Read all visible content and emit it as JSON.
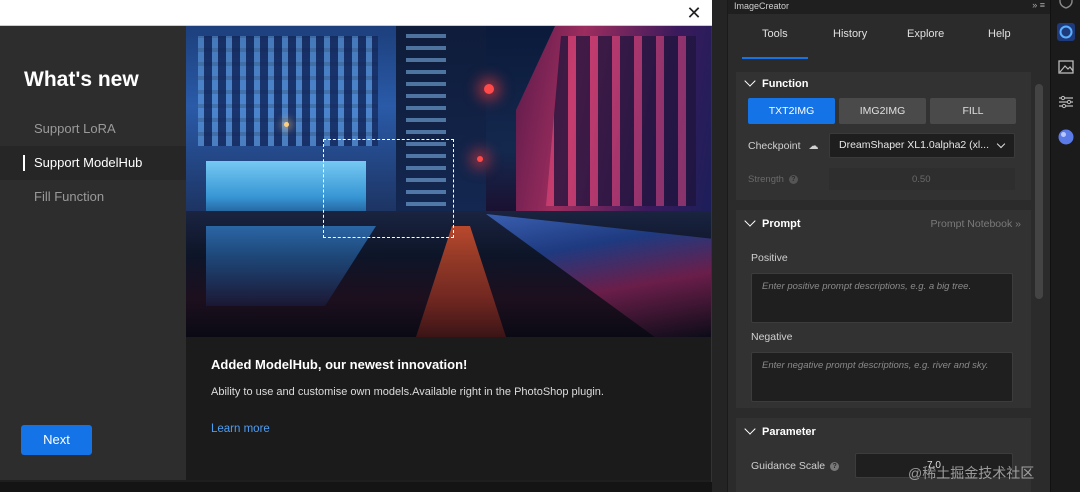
{
  "dialog": {
    "heading": "What's new",
    "nav": [
      {
        "label": "Support LoRA",
        "active": false
      },
      {
        "label": "Support ModelHub",
        "active": true
      },
      {
        "label": "Fill Function",
        "active": false
      }
    ],
    "next_label": "Next",
    "title": "Added ModelHub, our newest innovation!",
    "description": "Ability to use and customise own models.Available right in the PhotoShop plugin.",
    "learn_more": "Learn more"
  },
  "panel": {
    "title": "ImageCreator",
    "controls": "»  ≡",
    "tabs": [
      "Tools",
      "History",
      "Explore",
      "Help"
    ],
    "active_tab": "Tools",
    "function": {
      "heading": "Function",
      "buttons": [
        "TXT2IMG",
        "IMG2IMG",
        "FILL"
      ],
      "active": "TXT2IMG",
      "checkpoint_label": "Checkpoint",
      "checkpoint_value": "DreamShaper XL1.0alpha2 (xl...",
      "strength_label": "Strength",
      "strength_value": "0.50"
    },
    "prompt": {
      "heading": "Prompt",
      "notebook_link": "Prompt Notebook »",
      "positive_label": "Positive",
      "positive_placeholder": "Enter positive prompt descriptions, e.g. a big tree.",
      "negative_label": "Negative",
      "negative_placeholder": "Enter negative prompt descriptions, e.g. river and sky."
    },
    "parameter": {
      "heading": "Parameter",
      "guidance_label": "Guidance Scale",
      "guidance_value": "7.0"
    }
  },
  "watermark": "@稀土掘金技术社区",
  "colors": {
    "accent": "#1473e6",
    "link": "#4d9df2"
  }
}
